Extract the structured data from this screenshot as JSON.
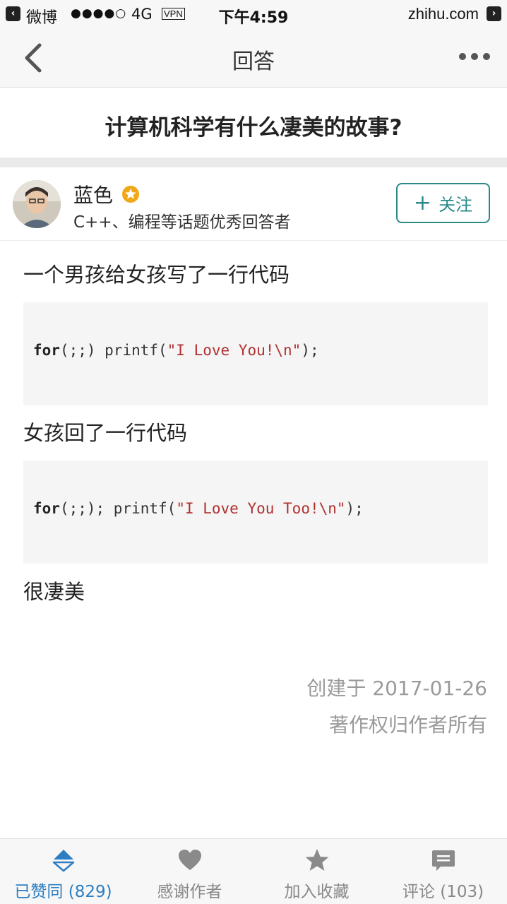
{
  "status_bar": {
    "back_app": "微博",
    "signal": "●●●●○",
    "network": "4G",
    "vpn": "VPN",
    "time": "下午4:59",
    "site": "zhihu.com"
  },
  "nav": {
    "title": "回答"
  },
  "question": {
    "title": "计算机科学有什么凄美的故事?"
  },
  "author": {
    "name": "蓝色",
    "description": "C++、编程等话题优秀回答者",
    "follow_label": "关注",
    "follow_plus": "+"
  },
  "answer": {
    "para1": "一个男孩给女孩写了一行代码",
    "code1": {
      "keyword": "for",
      "middle": "(;;) printf(",
      "string": "\"I Love You!\\n\"",
      "end": ");"
    },
    "para2": "女孩回了一行代码",
    "code2": {
      "keyword": "for",
      "middle": "(;;); printf(",
      "string": "\"I Love You Too!\\n\"",
      "end": ");"
    },
    "para3": "很凄美",
    "created": "创建于 2017-01-26",
    "copyright": "著作权归作者所有"
  },
  "tab_bar": {
    "tabs": [
      {
        "label": "已赞同 (829)",
        "icon": "upvote-icon",
        "active": true
      },
      {
        "label": "感谢作者",
        "icon": "heart-icon",
        "active": false
      },
      {
        "label": "加入收藏",
        "icon": "star-icon",
        "active": false
      },
      {
        "label": "评论 (103)",
        "icon": "comment-icon",
        "active": false
      }
    ]
  },
  "colors": {
    "accent": "#2d7fc1",
    "follow": "#2a8a8a",
    "string": "#b03030",
    "badge": "#f0a818"
  }
}
